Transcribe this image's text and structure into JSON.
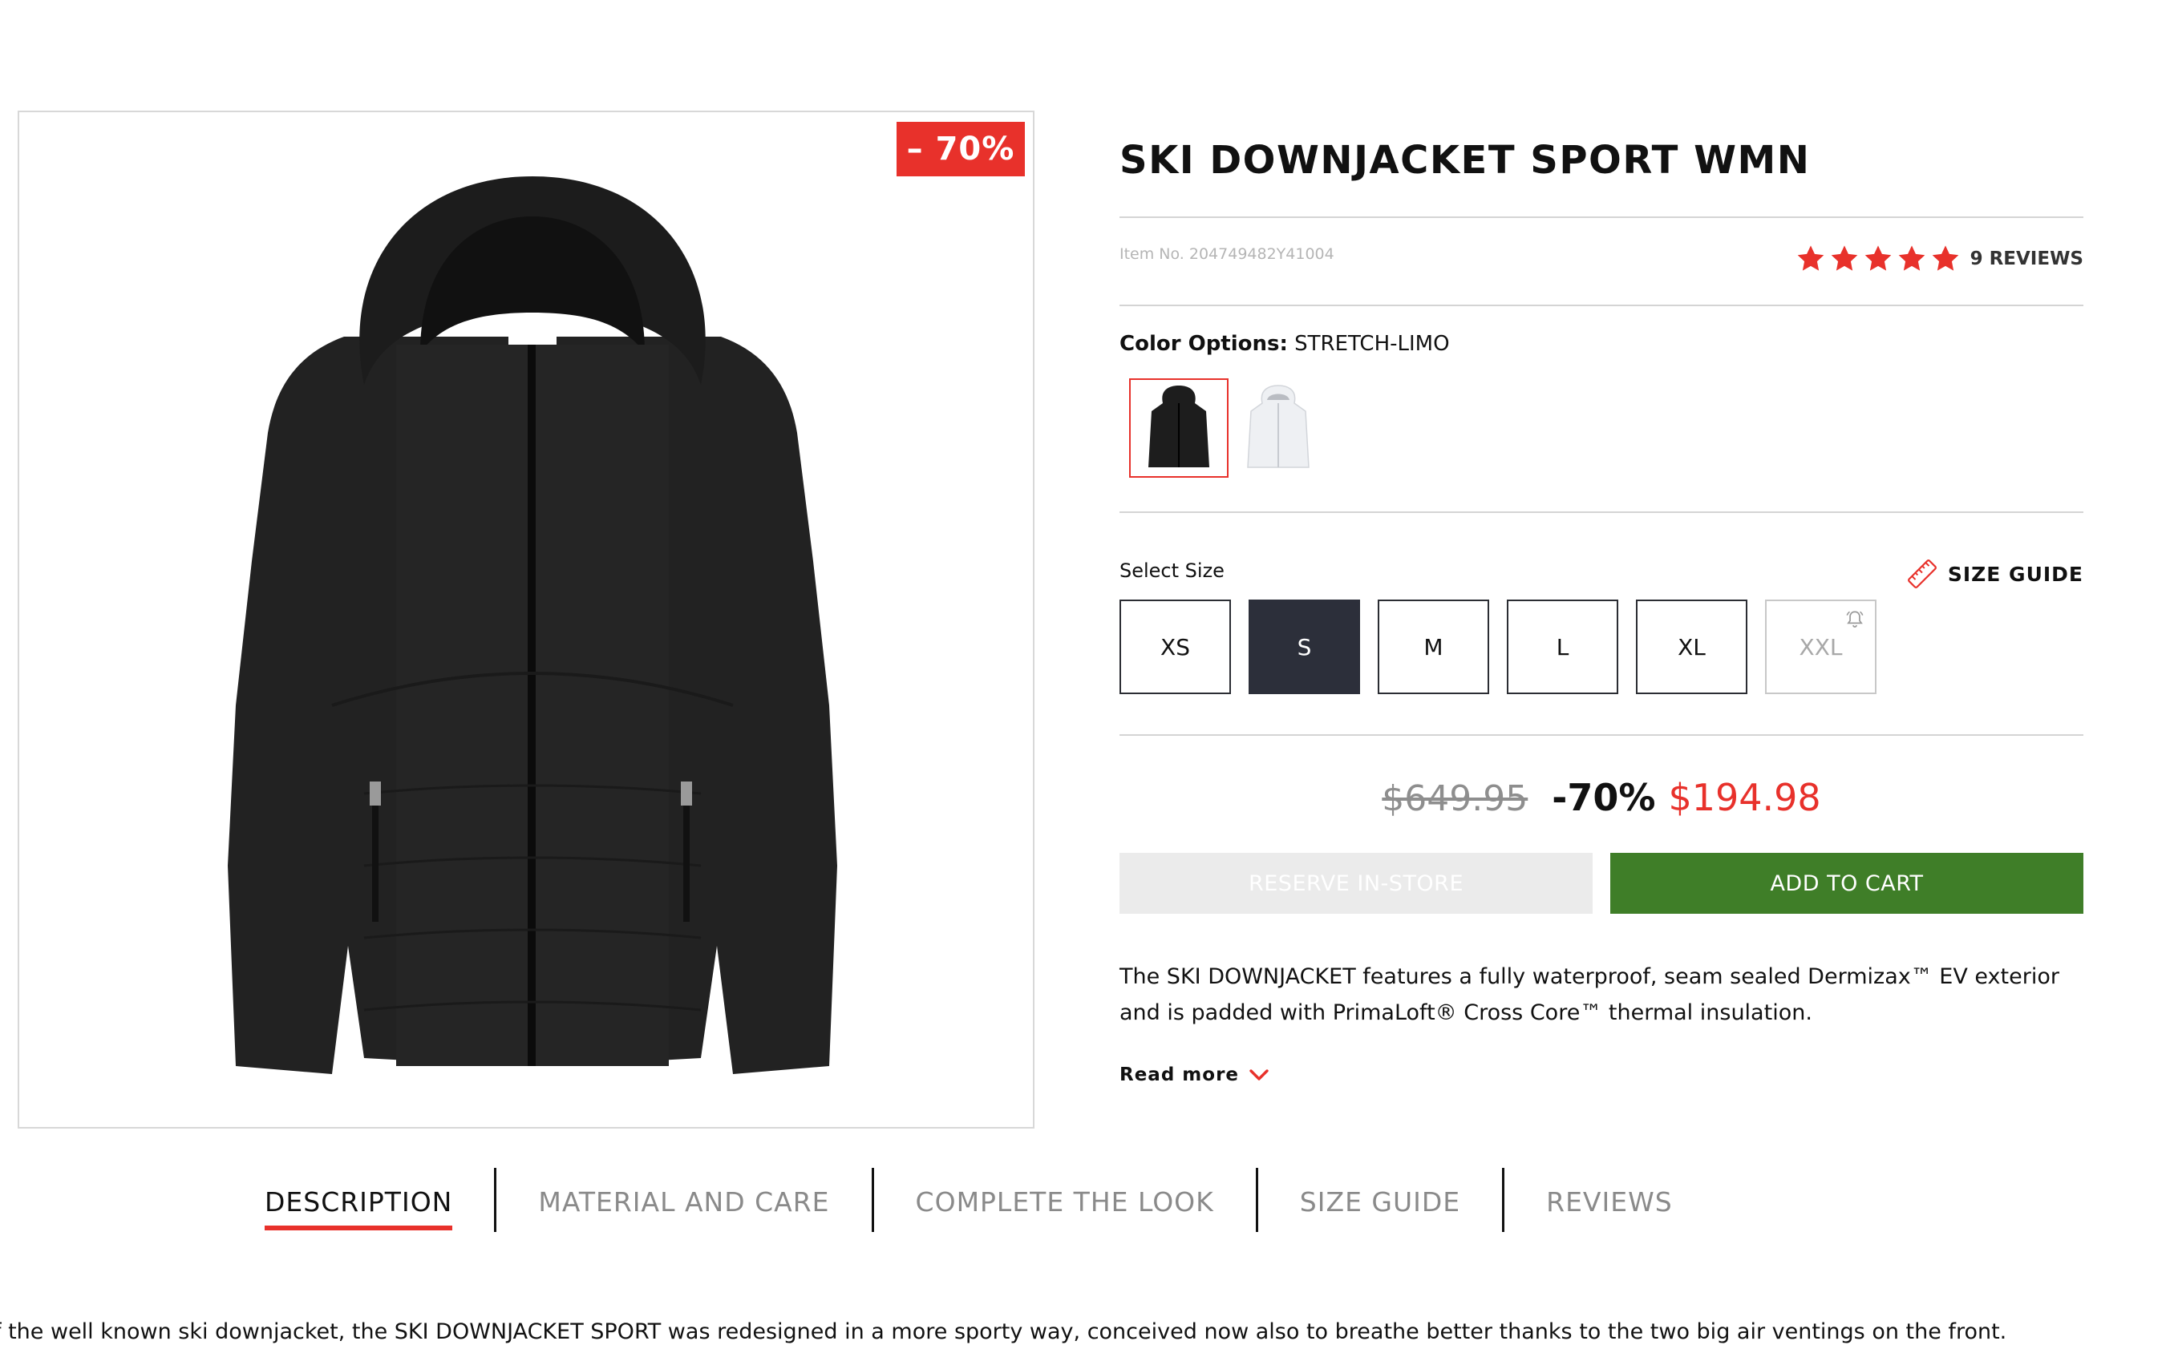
{
  "product": {
    "title": "SKI DOWNJACKET SPORT WMN",
    "discount_badge": "– 70%",
    "item_no": "Item No. 204749482Y41004",
    "rating": {
      "stars": 5,
      "max": 5,
      "reviews_label": "9 REVIEWS"
    }
  },
  "color": {
    "label": "Color Options:",
    "selected_value": "STRETCH-LIMO",
    "swatches": [
      {
        "name": "black",
        "color": "#1d1d1d"
      },
      {
        "name": "white",
        "color": "#f1f2f4"
      }
    ]
  },
  "size": {
    "label": "Select Size",
    "guide_label": "SIZE GUIDE",
    "options": [
      {
        "label": "XS",
        "state": "available"
      },
      {
        "label": "S",
        "state": "selected"
      },
      {
        "label": "M",
        "state": "available"
      },
      {
        "label": "L",
        "state": "available"
      },
      {
        "label": "XL",
        "state": "available"
      },
      {
        "label": "XXL",
        "state": "unavailable"
      }
    ]
  },
  "price": {
    "original": "$649.95",
    "discount": "-70%",
    "current": "$194.98"
  },
  "actions": {
    "reserve_label": "RESERVE IN-STORE",
    "cart_label": "ADD TO CART"
  },
  "description": {
    "short": "The SKI DOWNJACKET features a fully waterproof, seam sealed Dermizax™ EV exterior and is padded with PrimaLoft® Cross Core™ thermal insulation.",
    "read_more": "Read more",
    "long": "f the well known ski downjacket, the SKI DOWNJACKET SPORT was redesigned in a more sporty way, conceived now also to breathe better thanks to the two big air ventings on the front."
  },
  "tabs": [
    {
      "label": "DESCRIPTION",
      "active": true
    },
    {
      "label": "MATERIAL AND CARE",
      "active": false
    },
    {
      "label": "COMPLETE THE LOOK",
      "active": false
    },
    {
      "label": "SIZE GUIDE",
      "active": false
    },
    {
      "label": "REVIEWS",
      "active": false
    }
  ],
  "colors": {
    "accent": "#e8312b",
    "cart_green": "#3f7e28",
    "selected_size_bg": "#2c2f3a"
  }
}
